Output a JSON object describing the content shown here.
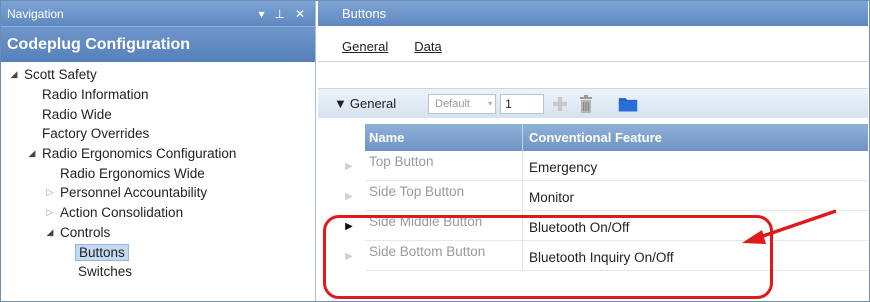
{
  "nav": {
    "header_title": "Navigation",
    "header_icons": [
      "dropdown-icon",
      "pin-icon",
      "close-icon"
    ],
    "banner_title": "Codeplug Configuration",
    "tree": [
      {
        "label": "Scott Safety",
        "level": 0,
        "expander": "expanded"
      },
      {
        "label": "Radio Information",
        "level": 1,
        "expander": "none"
      },
      {
        "label": "Radio Wide",
        "level": 1,
        "expander": "none"
      },
      {
        "label": "Factory Overrides",
        "level": 1,
        "expander": "none"
      },
      {
        "label": "Radio Ergonomics Configuration",
        "level": 1,
        "expander": "expanded"
      },
      {
        "label": "Radio Ergonomics Wide",
        "level": 2,
        "expander": "none"
      },
      {
        "label": "Personnel Accountability",
        "level": 2,
        "expander": "collapsed"
      },
      {
        "label": "Action Consolidation",
        "level": 2,
        "expander": "collapsed"
      },
      {
        "label": "Controls",
        "level": 2,
        "expander": "expanded"
      },
      {
        "label": "Buttons",
        "level": 3,
        "expander": "none",
        "selected": true
      },
      {
        "label": "Switches",
        "level": 3,
        "expander": "none"
      }
    ]
  },
  "main": {
    "header_title": "Buttons",
    "tabs": [
      "General",
      "Data"
    ],
    "section": {
      "title": "General",
      "dropdown_value": "Default",
      "number_value": "1"
    },
    "grid": {
      "columns": [
        "Name",
        "Conventional Feature"
      ],
      "rows": [
        {
          "name": "Top Button",
          "feature": "Emergency",
          "current": false
        },
        {
          "name": "Side Top Button",
          "feature": "Monitor",
          "current": false
        },
        {
          "name": "Side Middle Button",
          "feature": "Bluetooth On/Off",
          "current": true
        },
        {
          "name": "Side Bottom Button",
          "feature": "Bluetooth Inquiry On/Off",
          "current": false
        }
      ]
    }
  },
  "colors": {
    "header_blue": "#5f88c0",
    "grid_header": "#7a9dcc",
    "annotation_red": "#e01a1a"
  }
}
